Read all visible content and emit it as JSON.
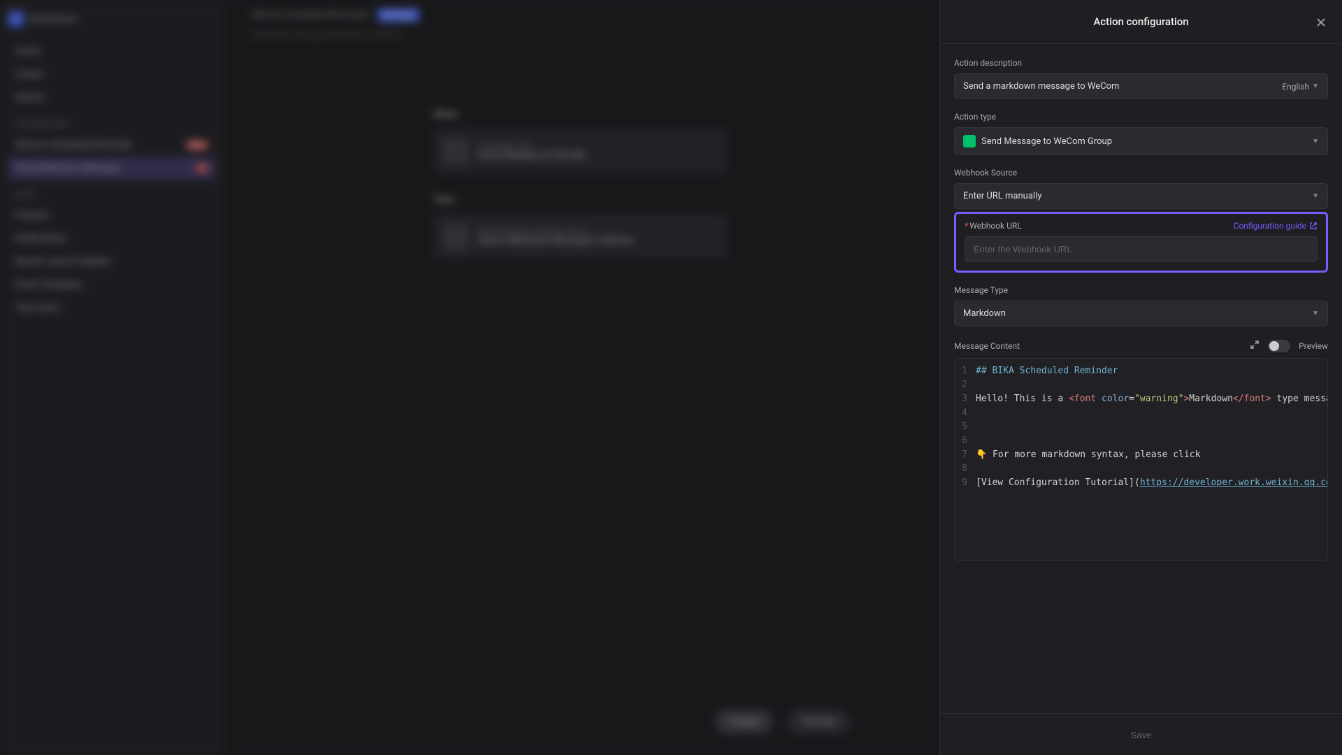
{
  "sidebar": {
    "workspace": "Workspace",
    "items_top": [
      "Home",
      "Library",
      "Shared"
    ],
    "section1": "Automations",
    "auto_items": [
      {
        "label": "WeCom Scheduled Reminder",
        "badge": "New"
      },
      {
        "label": "Send Markdown Message",
        "badge": "1"
      }
    ],
    "section2": "Data",
    "data_items": [
      "Projects",
      "Notifications",
      "Recent Launch Updates",
      "Email Templates",
      "Task Items"
    ]
  },
  "main": {
    "breadcrumb": "WeCom Scheduled Reminder",
    "running": "Running",
    "sub": "Scheduled message automation for WeCom",
    "when_label": "When",
    "when_card": {
      "sub": "Scheduled Time",
      "title": "Every Weekday at 9:00 AM"
    },
    "then_label": "Then",
    "then_card": {
      "sub": "Send Message to WeCom Group",
      "title": "Send a Markdown Message to WeCom"
    },
    "publish": "Publish",
    "testrun": "Test Run"
  },
  "panel": {
    "title": "Action configuration",
    "desc_label": "Action description",
    "desc_value": "Send a markdown message to WeCom",
    "lang": "English",
    "type_label": "Action type",
    "type_value": "Send Message to WeCom Group",
    "source_label": "Webhook Source",
    "source_value": "Enter URL manually",
    "url_label": "Webhook URL",
    "config_guide": "Configuration guide",
    "url_placeholder": "Enter the Webhook URL",
    "msgtype_label": "Message Type",
    "msgtype_value": "Markdown",
    "content_label": "Message Content",
    "preview_label": "Preview",
    "save": "Save",
    "code": {
      "l1": "## BIKA Scheduled Reminder",
      "l3_a": "Hello! This is a ",
      "l3_b": "<font",
      "l3_c": " color",
      "l3_d": "=",
      "l3_e": "\"warning\"",
      "l3_f": ">",
      "l3_g": "Markdown",
      "l3_h": "</font>",
      "l3_i": " type message",
      "l7": "👇 For more markdown syntax, please click",
      "l9_a": "[View Configuration Tutorial](",
      "l9_b": "https://developer.work.weixin.qq.com"
    }
  }
}
